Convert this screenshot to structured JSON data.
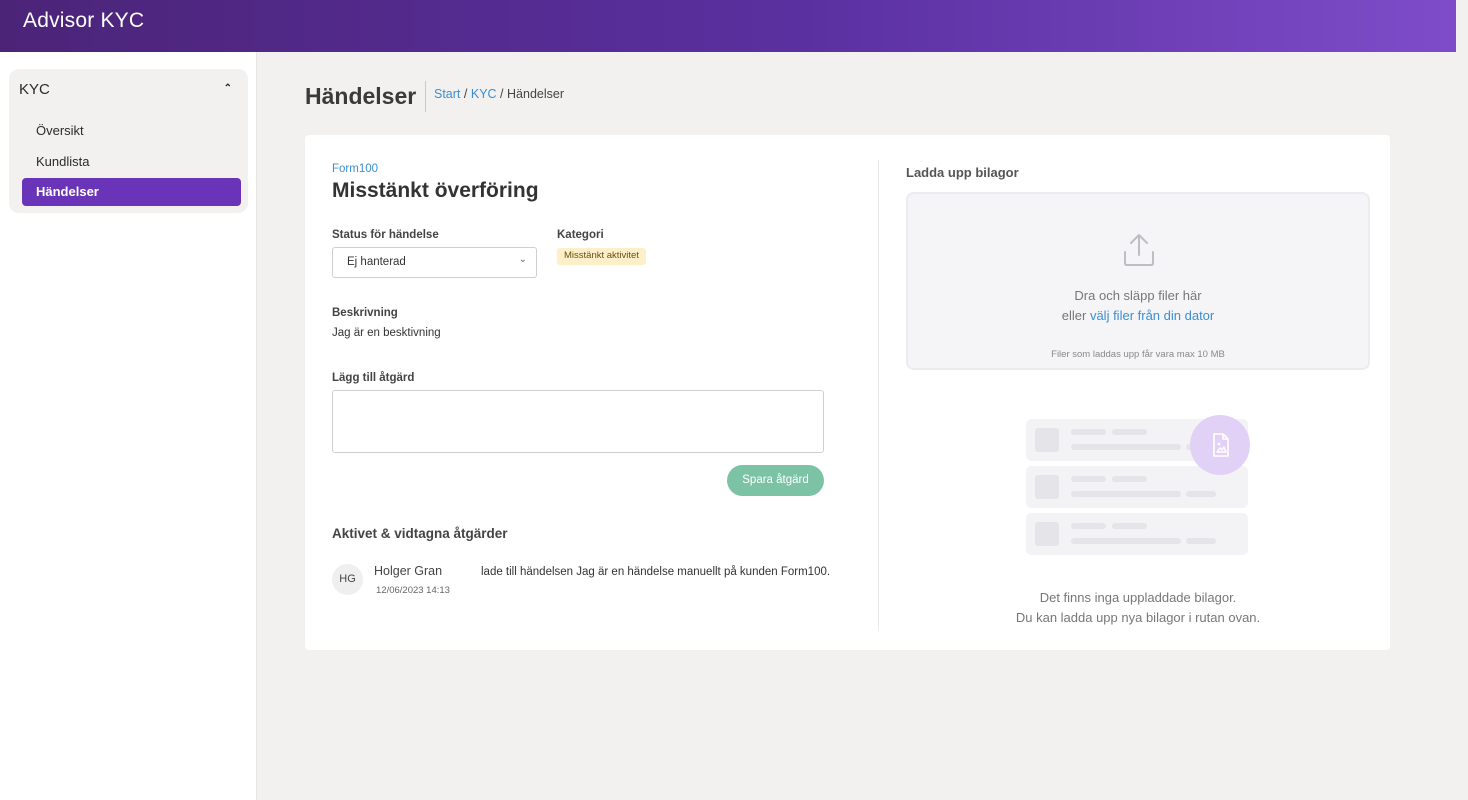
{
  "app": {
    "title": "Advisor KYC"
  },
  "sidebar": {
    "section_label": "KYC",
    "items": [
      {
        "label": "Översikt",
        "active": false
      },
      {
        "label": "Kundlista",
        "active": false
      },
      {
        "label": "Händelser",
        "active": true
      }
    ]
  },
  "page": {
    "title": "Händelser",
    "breadcrumb": {
      "start": "Start",
      "sep1": "/",
      "kyc": "KYC",
      "sep2": "/",
      "current": "Händelser"
    }
  },
  "event": {
    "form": "Form100",
    "title": "Misstänkt överföring",
    "status_label": "Status för händelse",
    "status_value": "Ej hanterad",
    "category_label": "Kategori",
    "category_value": "Misstänkt aktivitet",
    "description_label": "Beskrivning",
    "description_value": "Jag är en besktivning",
    "add_action_label": "Lägg till åtgärd",
    "save_label": "Spara åtgärd"
  },
  "activity": {
    "title": "Aktivet & vidtagna åtgärder",
    "items": [
      {
        "initials": "HG",
        "name": "Holger Gran",
        "date": "12/06/2023 14:13",
        "text": "lade till händelsen Jag är en händelse manuellt på kunden Form100."
      }
    ]
  },
  "upload": {
    "title": "Ladda upp bilagor",
    "drop_text": "Dra och släpp filer här",
    "or_text": "eller",
    "choose_link": "välj filer från din dator",
    "limit_text": "Filer som laddas upp får vara max 10 MB",
    "empty_line1": "Det finns inga uppladdade bilagor.",
    "empty_line2": "Du kan ladda upp nya bilagor i rutan ovan."
  },
  "colors": {
    "accent": "#6a34b8",
    "link": "#3a8fd0",
    "success": "#7cc2a5",
    "badge_bg": "#fdefc8"
  },
  "icons": {
    "collapse": "chevron-up-icon",
    "select_caret": "chevron-down-icon",
    "upload": "upload-icon",
    "file": "file-image-icon"
  }
}
